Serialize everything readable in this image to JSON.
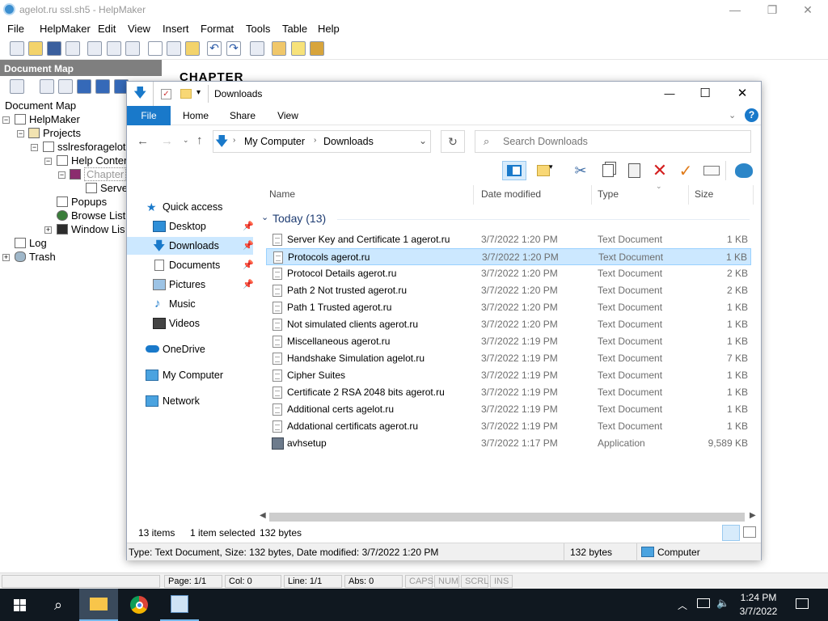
{
  "helpmaker": {
    "window_title": "agelot.ru ssl.sh5 - HelpMaker",
    "controls": {
      "minimize": "—",
      "maximize": "❐",
      "close": "✕"
    },
    "menu": [
      "File",
      "HelpMaker",
      "Edit",
      "View",
      "Insert",
      "Format",
      "Tools",
      "Table",
      "Help"
    ],
    "document_map_title": "Document Map",
    "document_map_label": "Document Map",
    "tree": [
      {
        "label": "HelpMaker"
      },
      {
        "label": "Projects"
      },
      {
        "label": "sslresforagelot"
      },
      {
        "label": "Help Conten"
      },
      {
        "label": "Chapter"
      },
      {
        "label": "Server"
      },
      {
        "label": "Popups"
      },
      {
        "label": "Browse List"
      },
      {
        "label": "Window Lis"
      },
      {
        "label": "Log"
      },
      {
        "label": "Trash"
      }
    ],
    "editor_text": "CHAPTER",
    "status": {
      "page": "Page: 1/1",
      "col": "Col: 0",
      "line": "Line: 1/1",
      "abs": "Abs: 0",
      "caps": "CAPS",
      "num": "NUM",
      "scrl": "SCRL",
      "ins": "INS"
    }
  },
  "explorer": {
    "title": "Downloads",
    "controls": {
      "minimize": "—",
      "maximize": "☐",
      "close": "✕"
    },
    "tabs": [
      "File",
      "Home",
      "Share",
      "View"
    ],
    "breadcrumb": [
      "My Computer",
      "Downloads"
    ],
    "search_placeholder": "Search Downloads",
    "nav": [
      {
        "label": "Quick access",
        "pinned": false
      },
      {
        "label": "Desktop",
        "pinned": true
      },
      {
        "label": "Downloads",
        "pinned": true
      },
      {
        "label": "Documents",
        "pinned": true
      },
      {
        "label": "Pictures",
        "pinned": true
      },
      {
        "label": "Music",
        "pinned": false
      },
      {
        "label": "Videos",
        "pinned": false
      },
      {
        "label": "OneDrive",
        "pinned": false
      },
      {
        "label": "My Computer",
        "pinned": false
      },
      {
        "label": "Network",
        "pinned": false
      }
    ],
    "columns": {
      "name": "Name",
      "date": "Date modified",
      "type": "Type",
      "size": "Size"
    },
    "group_label": "Today (13)",
    "files": [
      {
        "name": "Server Key and Certificate 1 agerot.ru",
        "date": "3/7/2022 1:20 PM",
        "type": "Text Document",
        "size": "1 KB",
        "selected": false
      },
      {
        "name": "Protocols agerot.ru",
        "date": "3/7/2022 1:20 PM",
        "type": "Text Document",
        "size": "1 KB",
        "selected": true
      },
      {
        "name": "Protocol Details agerot.ru",
        "date": "3/7/2022 1:20 PM",
        "type": "Text Document",
        "size": "2 KB",
        "selected": false
      },
      {
        "name": "Path 2 Not trusted agerot.ru",
        "date": "3/7/2022 1:20 PM",
        "type": "Text Document",
        "size": "2 KB",
        "selected": false
      },
      {
        "name": "Path 1 Trusted agerot.ru",
        "date": "3/7/2022 1:20 PM",
        "type": "Text Document",
        "size": "1 KB",
        "selected": false
      },
      {
        "name": "Not simulated clients agerot.ru",
        "date": "3/7/2022 1:20 PM",
        "type": "Text Document",
        "size": "1 KB",
        "selected": false
      },
      {
        "name": "Miscellaneous agerot.ru",
        "date": "3/7/2022 1:19 PM",
        "type": "Text Document",
        "size": "1 KB",
        "selected": false
      },
      {
        "name": "Handshake Simulation agelot.ru",
        "date": "3/7/2022 1:19 PM",
        "type": "Text Document",
        "size": "7 KB",
        "selected": false
      },
      {
        "name": "Cipher Suites",
        "date": "3/7/2022 1:19 PM",
        "type": "Text Document",
        "size": "1 KB",
        "selected": false
      },
      {
        "name": "Certificate 2 RSA 2048 bits agerot.ru",
        "date": "3/7/2022 1:19 PM",
        "type": "Text Document",
        "size": "1 KB",
        "selected": false
      },
      {
        "name": "Additional certs agelot.ru",
        "date": "3/7/2022 1:19 PM",
        "type": "Text Document",
        "size": "1 KB",
        "selected": false
      },
      {
        "name": "Addational certificats  agerot.ru",
        "date": "3/7/2022 1:19 PM",
        "type": "Text Document",
        "size": "1 KB",
        "selected": false
      },
      {
        "name": "avhsetup",
        "date": "3/7/2022 1:17 PM",
        "type": "Application",
        "size": "9,589 KB",
        "selected": false
      }
    ],
    "status": {
      "count": "13 items",
      "selected": "1 item selected",
      "bytes": "132 bytes"
    },
    "statusbar": {
      "info": "Type: Text Document, Size: 132 bytes, Date modified: 3/7/2022 1:20 PM",
      "bytes": "132 bytes",
      "location": "Computer"
    }
  },
  "taskbar": {
    "time": "1:24 PM",
    "date": "3/7/2022"
  },
  "colors": {
    "accent": "#1979ca",
    "selection": "#cce8ff",
    "taskbar": "#101820",
    "delete_red": "#d42020",
    "check_orange": "#e07b1a"
  }
}
